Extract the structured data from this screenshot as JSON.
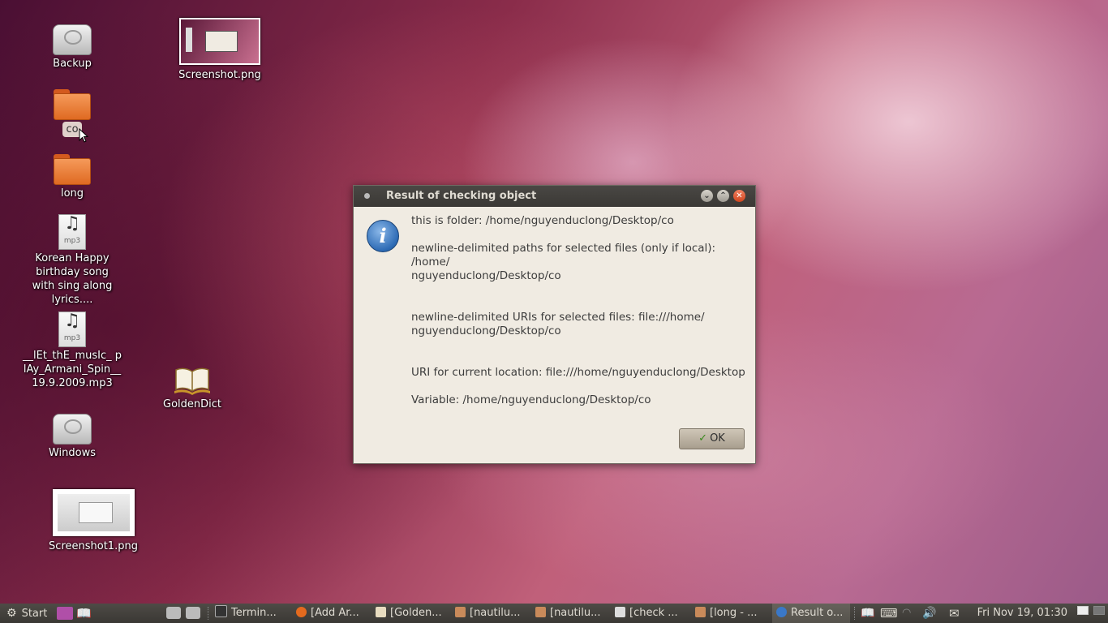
{
  "desktop": {
    "icons": [
      {
        "label": "Backup",
        "type": "drive"
      },
      {
        "label": "co",
        "type": "folder"
      },
      {
        "label": "long",
        "type": "folder"
      },
      {
        "label": "Korean Happy birthday song with sing along lyrics....",
        "type": "mp3",
        "badge": "mp3"
      },
      {
        "label": "__lEt_thE_musIc_ plAy_Armani_Spin__ 19.9.2009.mp3",
        "type": "mp3",
        "badge": "mp3"
      },
      {
        "label": "Windows",
        "type": "drive"
      },
      {
        "label": "Screenshot1.png",
        "type": "image"
      },
      {
        "label": "Screenshot.png",
        "type": "image"
      },
      {
        "label": "GoldenDict",
        "type": "app"
      }
    ]
  },
  "dialog": {
    "title": "Result of checking object",
    "icon": "info-icon",
    "lines": [
      "this is folder: /home/nguyenduclong/Desktop/co",
      "newline-delimited paths for selected files (only if local): /home/",
      "nguyenduclong/Desktop/co",
      "newline-delimited URIs for selected files: file:///home/",
      "nguyenduclong/Desktop/co",
      "URI for current location: file:///home/nguyenduclong/Desktop",
      "Variable: /home/nguyenduclong/Desktop/co"
    ],
    "ok_label": "OK"
  },
  "taskbar": {
    "start_label": "Start",
    "items": [
      {
        "label": "Termin...",
        "icon": "terminal-icon"
      },
      {
        "label": "[Add  Ar...",
        "icon": "firefox-icon"
      },
      {
        "label": "[Golden...",
        "icon": "goldendict-icon"
      },
      {
        "label": "[nautilu...",
        "icon": "folder-icon"
      },
      {
        "label": "[nautilu...",
        "icon": "folder-icon"
      },
      {
        "label": "[check ...",
        "icon": "editor-icon"
      },
      {
        "label": "[long - ...",
        "icon": "folder-icon"
      },
      {
        "label": "Result o...",
        "icon": "info-icon"
      }
    ],
    "clock": "Fri Nov 19, 01:30"
  }
}
